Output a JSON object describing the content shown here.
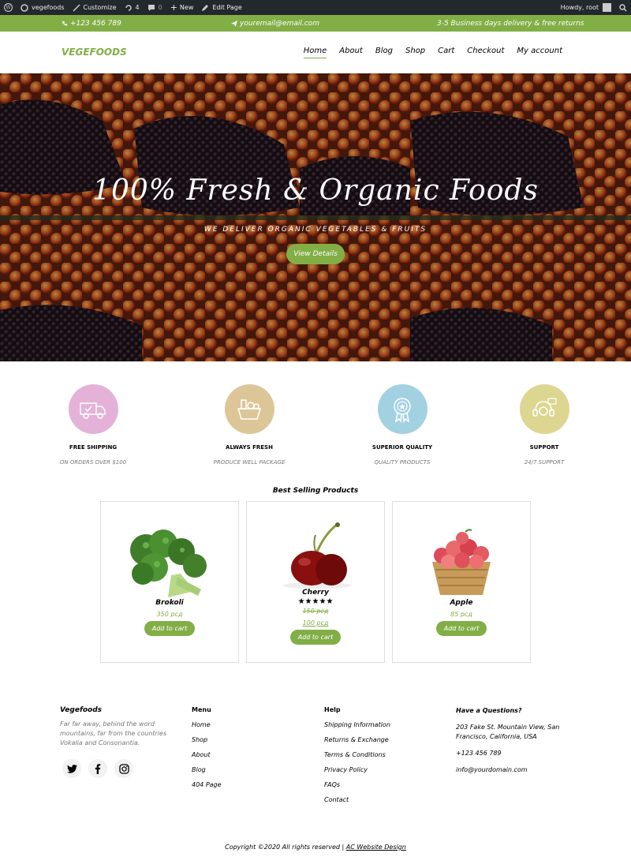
{
  "admin_bar": {
    "site_name": "vegefoods",
    "customize": "Customize",
    "updates": "4",
    "comments": "0",
    "new": "New",
    "edit_page": "Edit Page",
    "greeting": "Howdy, root"
  },
  "topbar": {
    "phone": "+123 456 789",
    "email": "youremail@email.com",
    "delivery": "3-5 Business days delivery & free returns"
  },
  "nav": {
    "brand": "VEGEFOODS",
    "items": [
      "Home",
      "About",
      "Blog",
      "Shop",
      "Cart",
      "Checkout",
      "My account"
    ],
    "active": "Home"
  },
  "hero": {
    "title": "100% Fresh & Organic Foods",
    "subtitle": "WE DELIVER ORGANIC VEGETABLES & FRUITS",
    "button": "View Details"
  },
  "services": [
    {
      "title": "FREE SHIPPING",
      "subtitle": "ON ORDERS OVER $100",
      "color": "#e4b2d8",
      "icon": "truck-icon"
    },
    {
      "title": "ALWAYS FRESH",
      "subtitle": "PRODUCE WELL PACKAGE",
      "color": "#dcc698",
      "icon": "basket-icon"
    },
    {
      "title": "SUPERIOR QUALITY",
      "subtitle": "QUALITY PRODUCTS",
      "color": "#a2d1e1",
      "icon": "award-icon"
    },
    {
      "title": "SUPPORT",
      "subtitle": "24/7 SUPPORT",
      "color": "#dcd691",
      "icon": "headset-icon"
    }
  ],
  "products_section": {
    "title": "Best Selling Products",
    "products": [
      {
        "name": "Brokoli",
        "price": "350 рсд",
        "button": "Add to cart"
      },
      {
        "name": "Cherry",
        "rating": "★★★★★",
        "old_price": "150 рсд",
        "price": "100 рсд",
        "button": "Add to cart"
      },
      {
        "name": "Apple",
        "price": "85 рсд",
        "button": "Add to cart"
      }
    ]
  },
  "footer": {
    "about": {
      "title": "Vegefoods",
      "text": "Far far away, behind the word mountains, far from the countries Vokalia and Consonantia."
    },
    "menu": {
      "title": "Menu",
      "links": [
        "Home",
        "Shop",
        "About",
        "Blog",
        "404 Page"
      ]
    },
    "help": {
      "title": "Help",
      "links": [
        "Shipping Information",
        "Returns & Exchange",
        "Terms & Conditions",
        "Privacy Policy",
        "FAQs",
        "Contact"
      ]
    },
    "contact": {
      "title": "Have a Questions?",
      "address": "203 Fake St. Mountain View, San Francisco, California, USA",
      "phone": "+123 456 789",
      "email": "info@yourdomain.com"
    },
    "social": [
      "twitter-icon",
      "facebook-icon",
      "instagram-icon"
    ],
    "copyright": "Copyright ©2020 All rights reserved |",
    "credit": "AC Website Design"
  },
  "colors": {
    "accent": "#82ae46",
    "admin_bar": "#23282d"
  }
}
